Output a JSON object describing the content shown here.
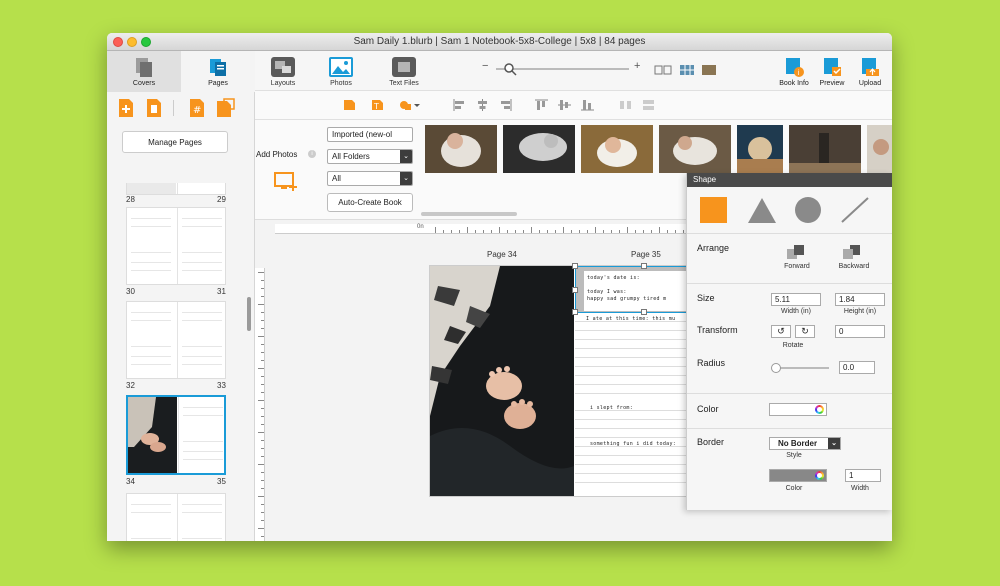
{
  "window": {
    "title": "Sam Daily 1.blurb | Sam 1 Notebook-5x8-College | 5x8 | 84 pages"
  },
  "sidebar": {
    "tabs": [
      {
        "label": "Covers"
      },
      {
        "label": "Pages"
      }
    ],
    "manage_pages": "Manage Pages",
    "spreads": [
      {
        "left": "28",
        "right": "29"
      },
      {
        "left": "30",
        "right": "31"
      },
      {
        "left": "32",
        "right": "33"
      },
      {
        "left": "34",
        "right": "35"
      }
    ]
  },
  "toolbar": {
    "left": [
      {
        "label": "Layouts"
      },
      {
        "label": "Photos"
      },
      {
        "label": "Text Files"
      }
    ],
    "right": [
      {
        "label": "Book Info"
      },
      {
        "label": "Preview"
      },
      {
        "label": "Upload"
      }
    ],
    "zoom_minus": "−",
    "zoom_plus": "+",
    "zoom_level": 0.1
  },
  "photos": {
    "add_label": "Add Photos",
    "selects": [
      {
        "value": "Imported (new-ol"
      },
      {
        "value": "All Folders"
      },
      {
        "value": "All"
      }
    ],
    "auto_create": "Auto-Create Book"
  },
  "canvas": {
    "ruler_origin": "0n",
    "left_page": "Page 34",
    "right_page": "Page 35",
    "notebook": {
      "date": "today's date is:",
      "mood_1": "today I was:",
      "mood_2": "happy  sad  grumpy  tired  m",
      "ate": "I ate at this time:   this mu",
      "slept": "i slept from:",
      "fun": "something fun i did today:"
    }
  },
  "shape_panel": {
    "title": "Shape",
    "arrange_label": "Arrange",
    "forward": "Forward",
    "backward": "Backward",
    "size_label": "Size",
    "width_value": "5.11",
    "height_value": "1.84",
    "width_unit": "Width (in)",
    "height_unit": "Height (in)",
    "transform_label": "Transform",
    "rotate_label": "Rotate",
    "rotate_value": "0",
    "radius_label": "Radius",
    "radius_value": "0.0",
    "color_label": "Color",
    "border_label": "Border",
    "border_style": "No Border",
    "style_label": "Style",
    "border_color_label": "Color",
    "border_width_value": "1",
    "width_label": "Width",
    "colors": {
      "shape_orange": "#f7941d",
      "border_fill": "#888888",
      "accent_blue": "#1a9bd7"
    }
  }
}
